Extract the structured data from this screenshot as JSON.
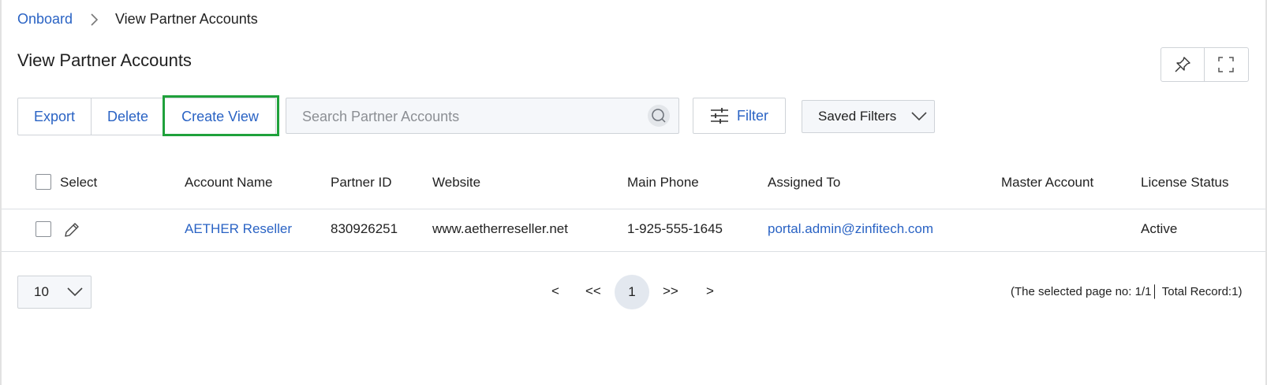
{
  "breadcrumb": {
    "root": "Onboard",
    "current": "View Partner Accounts"
  },
  "page": {
    "title": "View Partner Accounts"
  },
  "header_actions": {
    "pin_icon": "pin-icon",
    "fullscreen_icon": "fullscreen-icon"
  },
  "toolbar": {
    "export_label": "Export",
    "delete_label": "Delete",
    "create_view_label": "Create View",
    "search_placeholder": "Search Partner Accounts",
    "filter_label": "Filter",
    "saved_filters_label": "Saved Filters"
  },
  "table": {
    "columns": [
      "Select",
      "Account Name",
      "Partner ID",
      "Website",
      "Main Phone",
      "Assigned To",
      "Master Account",
      "License Status"
    ],
    "rows": [
      {
        "account_name": "AETHER Reseller",
        "partner_id": "830926251",
        "website": "www.aetherreseller.net",
        "main_phone": "1-925-555-1645",
        "assigned_to": "portal.admin@zinfitech.com",
        "master_account": "",
        "license_status": "Active"
      }
    ]
  },
  "pagination": {
    "page_size": "10",
    "prev": "<",
    "first": "<<",
    "current_page": "1",
    "last": ">>",
    "next": ">",
    "info": "(The selected page no: 1/1│ Total Record:1)"
  },
  "colors": {
    "link": "#2a63c4",
    "highlight": "#1fa13b",
    "border": "#cfd3d8"
  }
}
